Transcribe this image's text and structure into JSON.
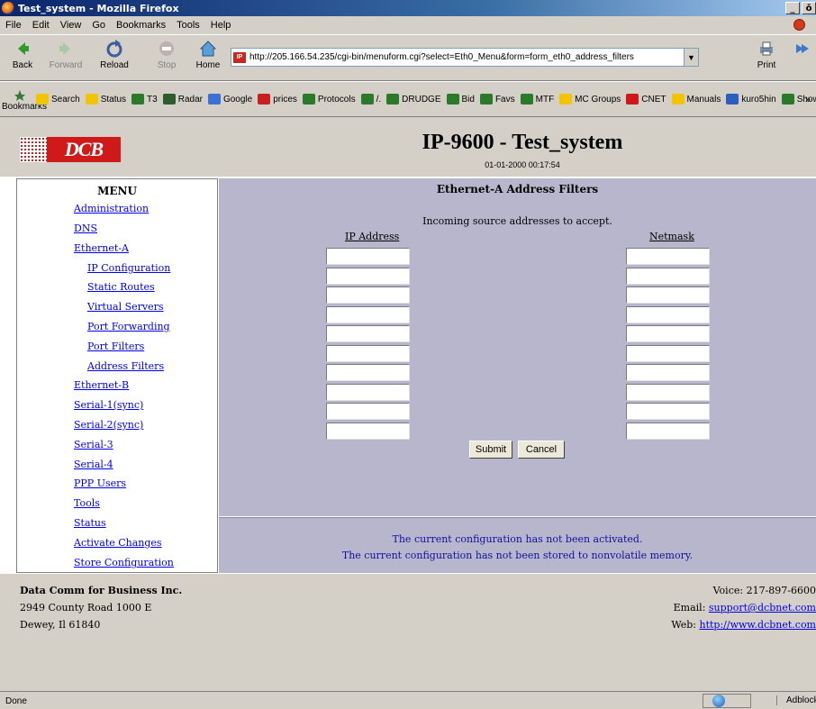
{
  "window": {
    "title": "Test_system - Mozilla Firefox",
    "min": "_",
    "restore": "ǒ",
    "close": "x"
  },
  "menubar": [
    "File",
    "Edit",
    "View",
    "Go",
    "Bookmarks",
    "Tools",
    "Help"
  ],
  "toolbar": {
    "back": "Back",
    "forward": "Forward",
    "reload": "Reload",
    "stop": "Stop",
    "home": "Home",
    "print": "Print",
    "url": "http://205.166.54.235/cgi-bin/menuform.cgi?select=Eth0_Menu&form=form_eth0_address_filters",
    "site_icon": "IP"
  },
  "bookmarks": {
    "main": "Bookmarks",
    "items": [
      {
        "label": "Search",
        "icon": "folder-icon",
        "color": "#f5c400"
      },
      {
        "label": "Status",
        "icon": "folder-icon",
        "color": "#f5c400"
      },
      {
        "label": "T3",
        "icon": "bookmark-icon",
        "color": "#2a7a2a"
      },
      {
        "label": "Radar",
        "icon": "radar-icon",
        "color": "#2d5c2d"
      },
      {
        "label": "Google",
        "icon": "google-icon",
        "color": "#3b70d4"
      },
      {
        "label": "prices",
        "icon": "pdf-icon",
        "color": "#c82020"
      },
      {
        "label": "Protocols",
        "icon": "bookmark-icon",
        "color": "#2a7a2a"
      },
      {
        "label": "/.",
        "icon": "slashdot-icon",
        "color": "#2a7a2a"
      },
      {
        "label": "DRUDGE",
        "icon": "bookmark-icon",
        "color": "#2a7a2a"
      },
      {
        "label": "Bid",
        "icon": "bookmark-icon",
        "color": "#2a7a2a"
      },
      {
        "label": "Favs",
        "icon": "bookmark-icon",
        "color": "#2a7a2a"
      },
      {
        "label": "MTF",
        "icon": "bookmark-icon",
        "color": "#2a7a2a"
      },
      {
        "label": "MC Groups",
        "icon": "folder-icon",
        "color": "#f5c400"
      },
      {
        "label": "CNET",
        "icon": "cnet-icon",
        "color": "#d01818"
      },
      {
        "label": "Manuals",
        "icon": "folder-icon",
        "color": "#f5c400"
      },
      {
        "label": "kuro5hin",
        "icon": "kuro5hin-icon",
        "color": "#2a5fc0"
      },
      {
        "label": "ShowCookie",
        "icon": "bookmark-icon",
        "color": "#2a7a2a"
      }
    ],
    "more": "»"
  },
  "page": {
    "logo_text": "DCB",
    "title": "IP-9600 - Test_system",
    "date": "01-01-2000 00:17:54"
  },
  "menu": {
    "title": "MENU",
    "items": [
      "Administration",
      "DNS",
      "Ethernet-A",
      "IP Configuration",
      "Static Routes",
      "Virtual Servers",
      "Port Forwarding",
      "Port Filters",
      "Address Filters",
      "Ethernet-B",
      "Serial-1(sync)",
      "Serial-2(sync)",
      "Serial-3",
      "Serial-4",
      "PPP Users",
      "Tools",
      "Status",
      "Activate Changes",
      "Store Configuration"
    ]
  },
  "form": {
    "heading": "Ethernet-A Address Filters",
    "subheading": "Incoming source addresses to accept.",
    "col_ip": "IP Address",
    "col_mask": "Netmask",
    "rows": [
      "",
      "",
      "",
      "",
      "",
      "",
      "",
      "",
      "",
      ""
    ],
    "submit": "Submit",
    "cancel": "Cancel"
  },
  "messages": {
    "line1": "The current configuration has not been activated.",
    "line2": "The current configuration has not been stored to nonvolatile memory."
  },
  "footer": {
    "company": "Data Comm for Business Inc.",
    "address1": "2949 County Road 1000 E",
    "address2": "Dewey, Il 61840",
    "voice": "Voice: 217-897-6600",
    "email_label": "Email: ",
    "email": "support@dcbnet.com",
    "web_label": "Web: ",
    "web": "http://www.dcbnet.com"
  },
  "status": {
    "text": "Done",
    "adblock": "Adblock"
  }
}
